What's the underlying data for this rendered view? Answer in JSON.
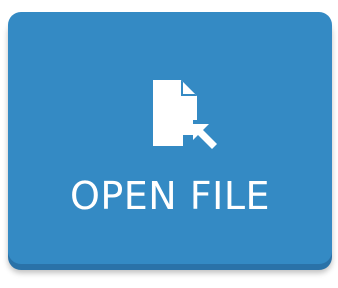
{
  "button": {
    "label": "OPEN FILE",
    "icon": "open-file-icon"
  },
  "colors": {
    "background": "#ffffff",
    "button_fill": "#348ac4",
    "button_edge": "#2a72a8",
    "text": "#ffffff"
  }
}
